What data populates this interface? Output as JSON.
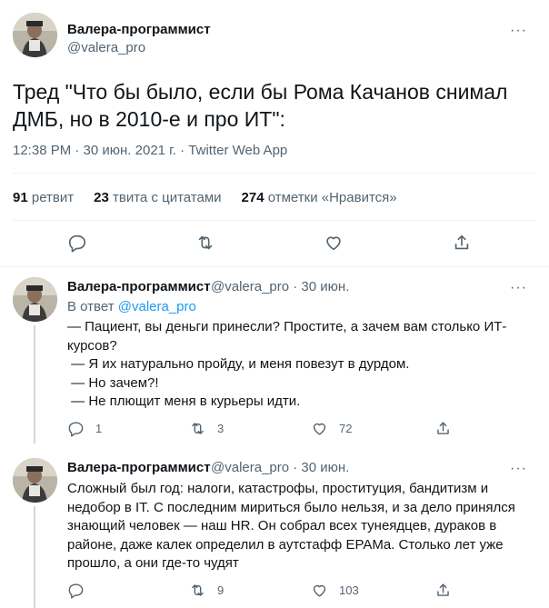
{
  "main_tweet": {
    "author_name": "Валера-программист",
    "author_handle": "@valera_pro",
    "more": "···",
    "text": "Тред \"Что бы было, если бы Рома Качанов снимал ДМБ, но в 2010-е и про ИТ\":",
    "meta": "12:38 PM · 30 июн. 2021 г. · Twitter Web App",
    "stats": {
      "retweets_count": "91",
      "retweets_label": "ретвит",
      "quotes_count": "23",
      "quotes_label": "твита с цитатами",
      "likes_count": "274",
      "likes_label": "отметки «Нравится»"
    },
    "actions": [
      "reply-icon",
      "retweet-icon",
      "like-icon",
      "share-icon"
    ]
  },
  "replies": [
    {
      "author_name": "Валера-программист",
      "handle_date": "@valera_pro · 30 июн.",
      "more": "···",
      "reply_prefix": "В ответ",
      "reply_to": "@valera_pro",
      "lines": [
        "— Пациент, вы деньги принесли? Простите, а зачем вам столько ИТ-",
        "курсов?",
        " — Я их натурально пройду, и меня повезут в дурдом.",
        " — Но зачем?!",
        " — Не плющит меня в курьеры идти."
      ],
      "replies_count": "1",
      "retweets_count": "3",
      "likes_count": "72"
    },
    {
      "author_name": "Валера-программист",
      "handle_date": "@valera_pro · 30 июн.",
      "more": "···",
      "lines": [
        "Сложный был год: налоги, катастрофы, проституция, бандитизм и",
        "недобор в IT. С последним мириться было нельзя, и за дело принялся",
        "знающий человек — наш HR. Он собрал всех тунеядцев, дураков в",
        "районе, даже калек определил в аутстафф EPAMа. Столько лет уже",
        "прошло, а они где-то чудят"
      ],
      "replies_count": "",
      "retweets_count": "9",
      "likes_count": "103"
    }
  ]
}
